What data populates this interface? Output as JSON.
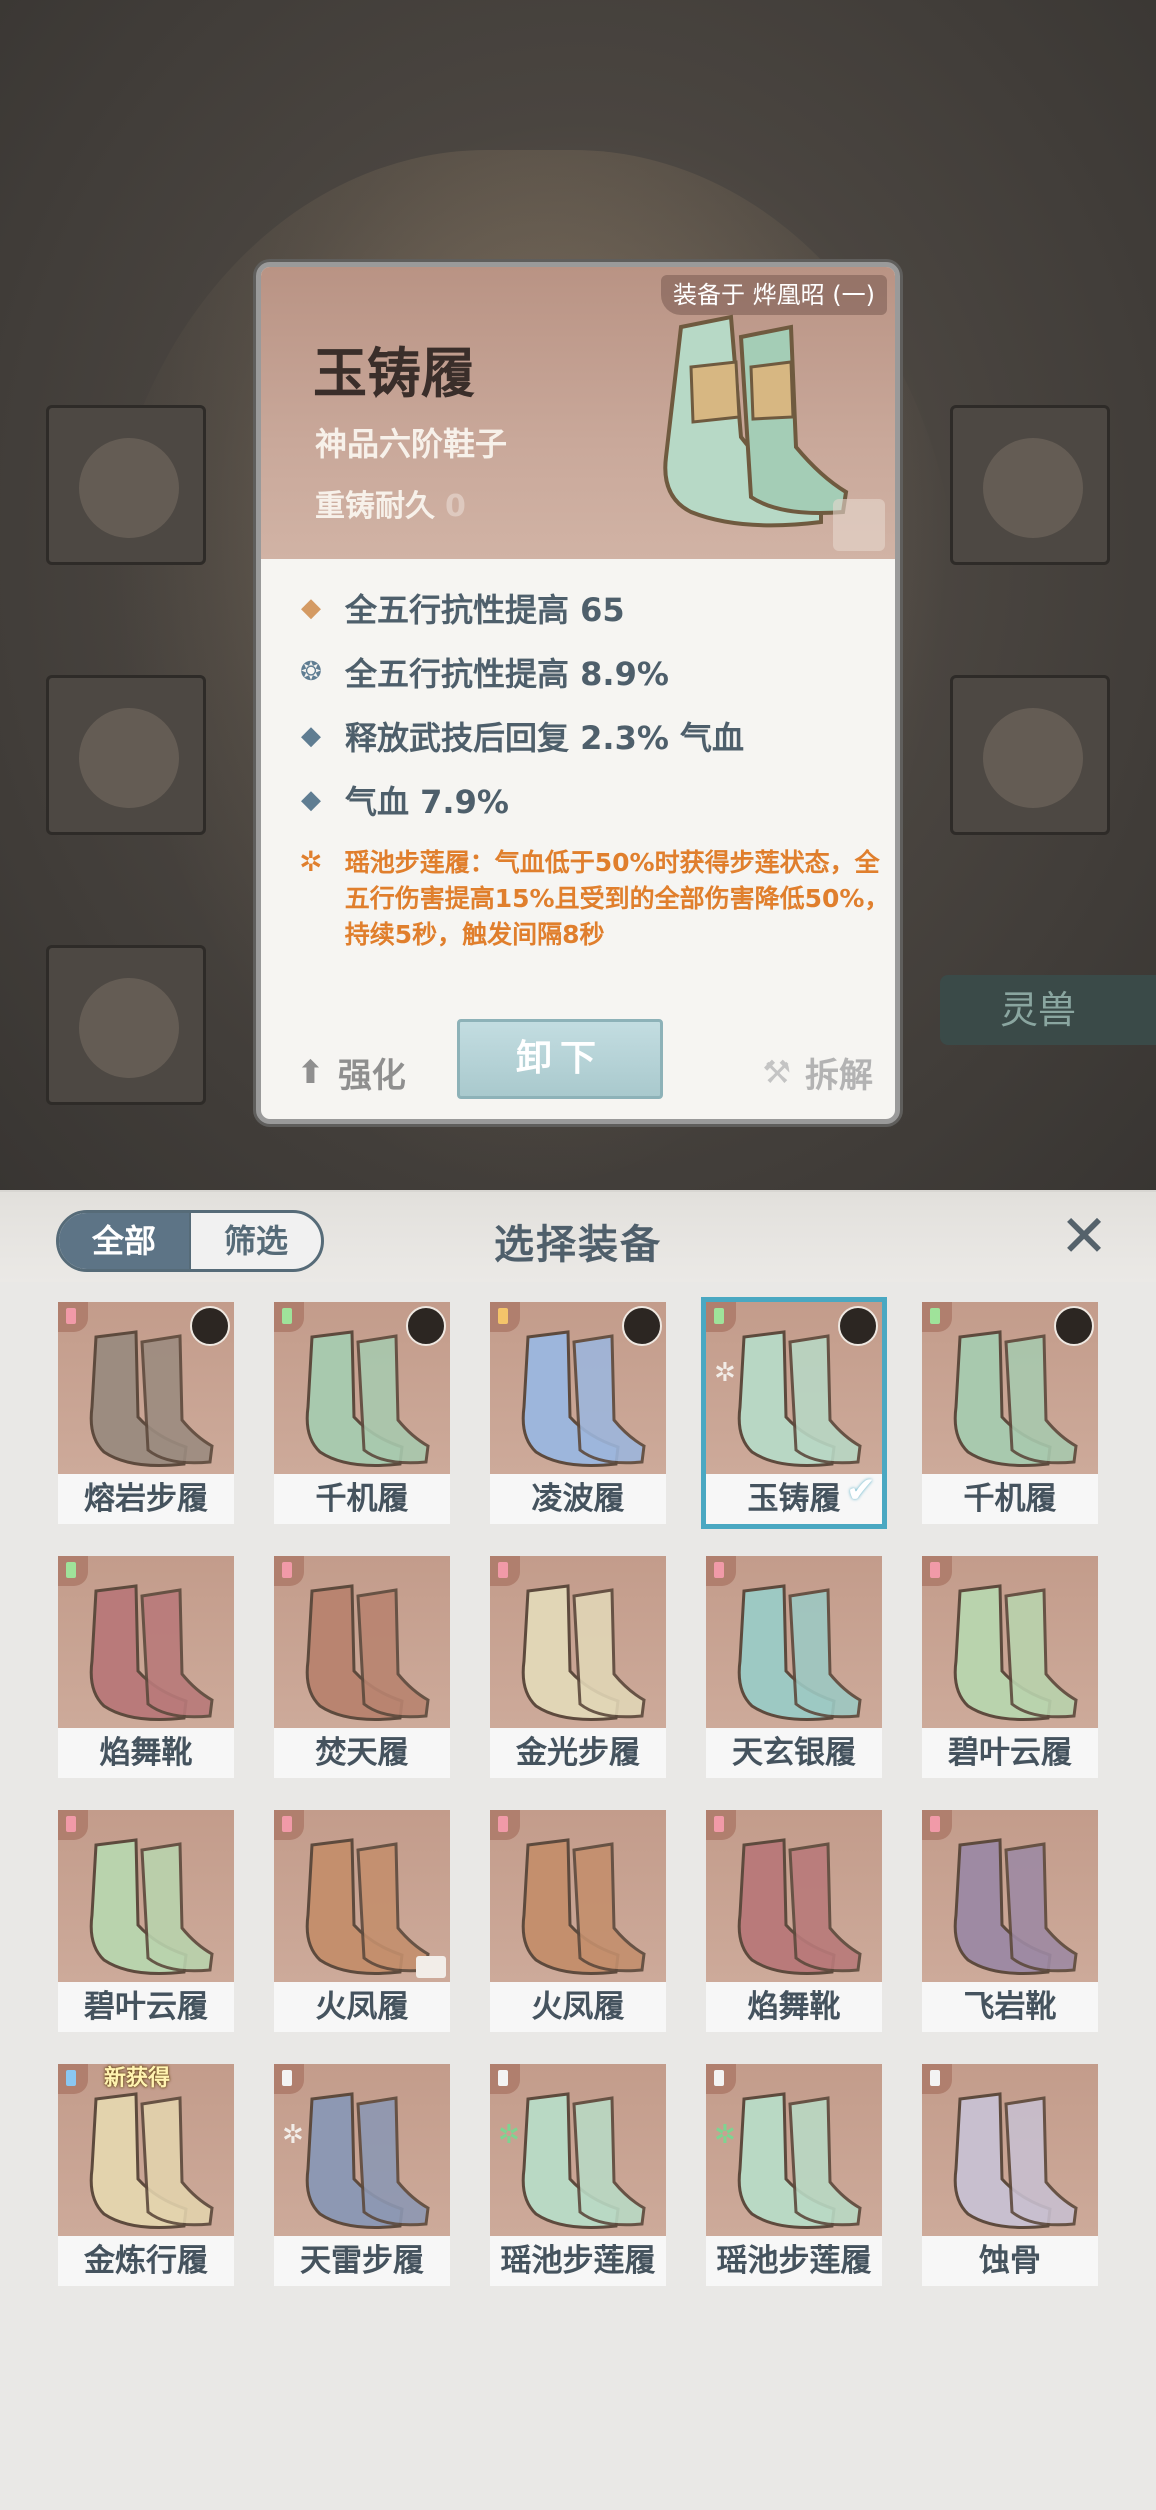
{
  "background": {
    "spirit_beast_label": "灵兽"
  },
  "detail": {
    "equipped_on": "装备于 烨凰昭 (一)",
    "name": "玉铸履",
    "grade": "神品六阶鞋子",
    "durability_label": "重铸耐久",
    "durability_value": "0",
    "stats": [
      "全五行抗性提高 65",
      "全五行抗性提高 8.9%",
      "释放武技后回复 2.3% 气血",
      "气血 7.9%"
    ],
    "set_skill": "瑶池步莲履：气血低于50%时获得步莲状态，全五行伤害提高15%且受到的全部伤害降低50%，持续5秒，触发间隔8秒",
    "unequip_label": "卸下",
    "strengthen_label": "强化",
    "dismantle_label": "拆解"
  },
  "panel": {
    "tab_all": "全部",
    "tab_filter": "筛选",
    "title": "选择装备",
    "close_icon": "close-icon",
    "items": [
      {
        "name": "熔岩步履",
        "slot": "pink",
        "boot": "#9c8c80"
      },
      {
        "name": "千机履",
        "slot": "green",
        "boot": "#a8c9ae"
      },
      {
        "name": "凌波履",
        "slot": "gold",
        "boot": "#9db6dc"
      },
      {
        "name": "玉铸履",
        "slot": "green",
        "boot": "#b8d7c4"
      },
      {
        "name": "千机履",
        "slot": "green",
        "boot": "#a8c9ae"
      },
      {
        "name": "焰舞靴",
        "slot": "green",
        "boot": "#b97a7a"
      },
      {
        "name": "焚天履",
        "slot": "pink",
        "boot": "#b98470"
      },
      {
        "name": "金光步履",
        "slot": "pink",
        "boot": "#e1d6b6"
      },
      {
        "name": "天玄银履",
        "slot": "pink",
        "boot": "#9dc9c3"
      },
      {
        "name": "碧叶云履",
        "slot": "pink",
        "boot": "#b9d3ad"
      },
      {
        "name": "碧叶云履",
        "slot": "pink",
        "boot": "#b9d3ad"
      },
      {
        "name": "火凤履",
        "slot": "pink",
        "boot": "#c48f6d"
      },
      {
        "name": "火凤履",
        "slot": "pink",
        "boot": "#c48f6d"
      },
      {
        "name": "焰舞靴",
        "slot": "pink",
        "boot": "#b97a7a"
      },
      {
        "name": "飞岩靴",
        "slot": "pink",
        "boot": "#9e8aa3"
      },
      {
        "name": "金炼行履",
        "slot": "blue",
        "boot": "#e3d3ad",
        "new_tag": "新获得"
      },
      {
        "name": "天雷步履",
        "slot": "white",
        "boot": "#8d98b3"
      },
      {
        "name": "瑶池步莲履",
        "slot": "white",
        "boot": "#b9d9c4"
      },
      {
        "name": "瑶池步莲履",
        "slot": "white",
        "boot": "#b9d9c4"
      },
      {
        "name": "蚀骨",
        "slot": "white",
        "boot": "#c8bfcf"
      }
    ]
  },
  "colors": {
    "accent_selected": "#4aa8c2",
    "skill_text": "#e07f2d",
    "stat_text": "#4e5f6b"
  }
}
